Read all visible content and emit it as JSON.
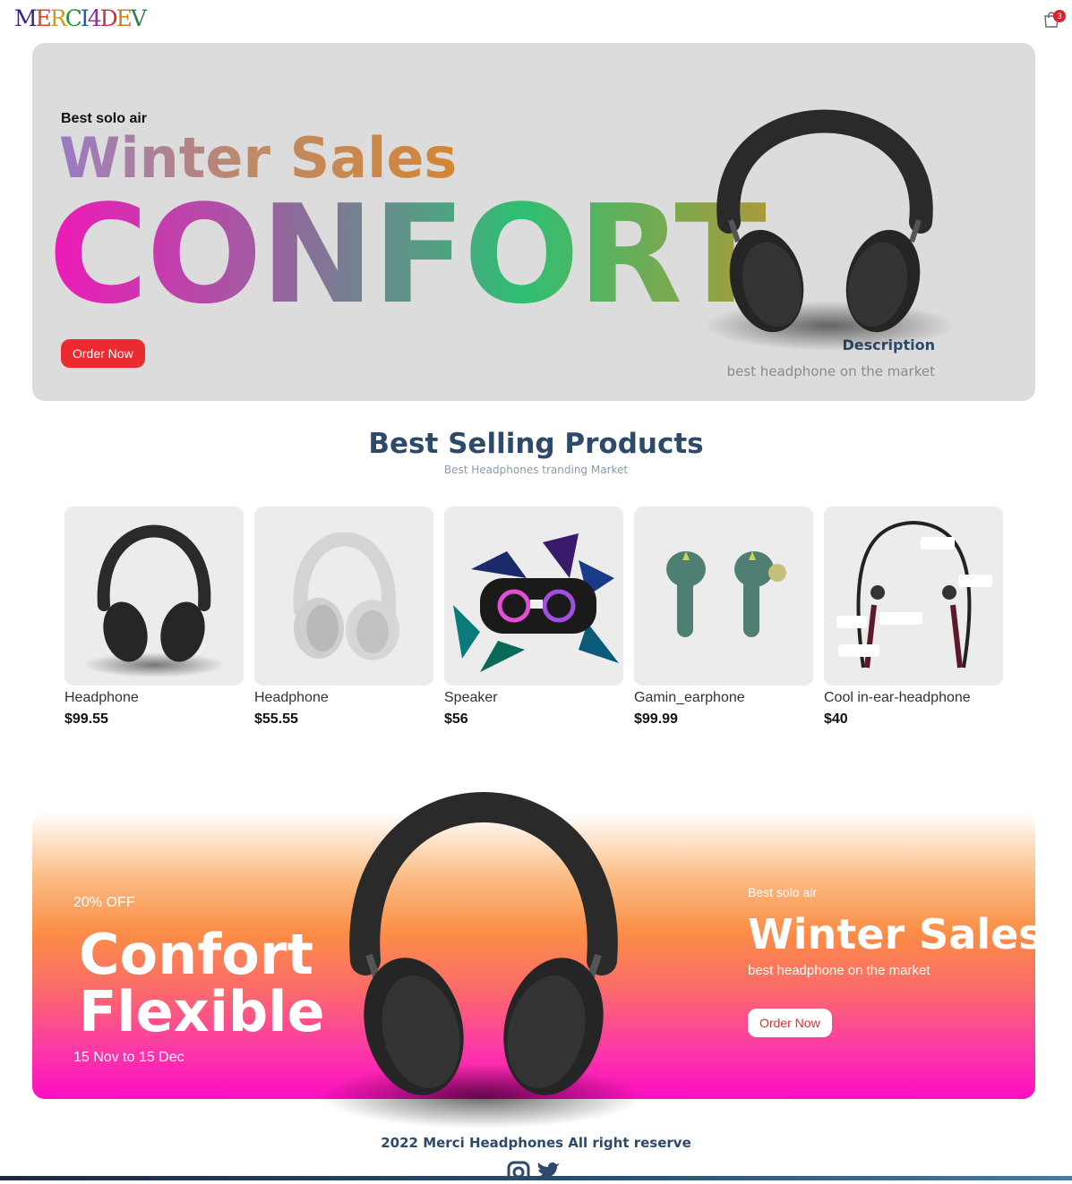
{
  "header": {
    "logo_letters": [
      "M",
      "E",
      "R",
      "C",
      "I",
      "4",
      "D",
      "E",
      "V"
    ],
    "cart_count": "3",
    "cart_icon": "shopping-bag-icon"
  },
  "hero": {
    "subtitle": "Best solo air",
    "title": "Winter Sales",
    "big_text": "CONFORT",
    "button": "Order Now",
    "desc_title": "Description",
    "desc_text": "best headphone on the market"
  },
  "best_selling": {
    "title": "Best Selling Products",
    "subtitle": "Best Headphones tranding Market",
    "products": [
      {
        "name": "Headphone",
        "price": "$99.55"
      },
      {
        "name": "Headphone",
        "price": "$55.55"
      },
      {
        "name": "Speaker",
        "price": "$56"
      },
      {
        "name": "Gamin_earphone",
        "price": "$99.99"
      },
      {
        "name": "Cool in-ear-headphone",
        "price": "$40"
      }
    ]
  },
  "promo": {
    "discount": "20% OFF",
    "line1": "Confort",
    "line2": "Flexible",
    "dates": "15 Nov to 15 Dec",
    "subtitle": "Best solo air",
    "title": "Winter Sales",
    "desc": "best headphone on the market",
    "button": "Order Now"
  },
  "footer": {
    "text": "2022 Merci Headphones All right reserve",
    "icons": [
      "instagram-icon",
      "twitter-icon"
    ]
  }
}
